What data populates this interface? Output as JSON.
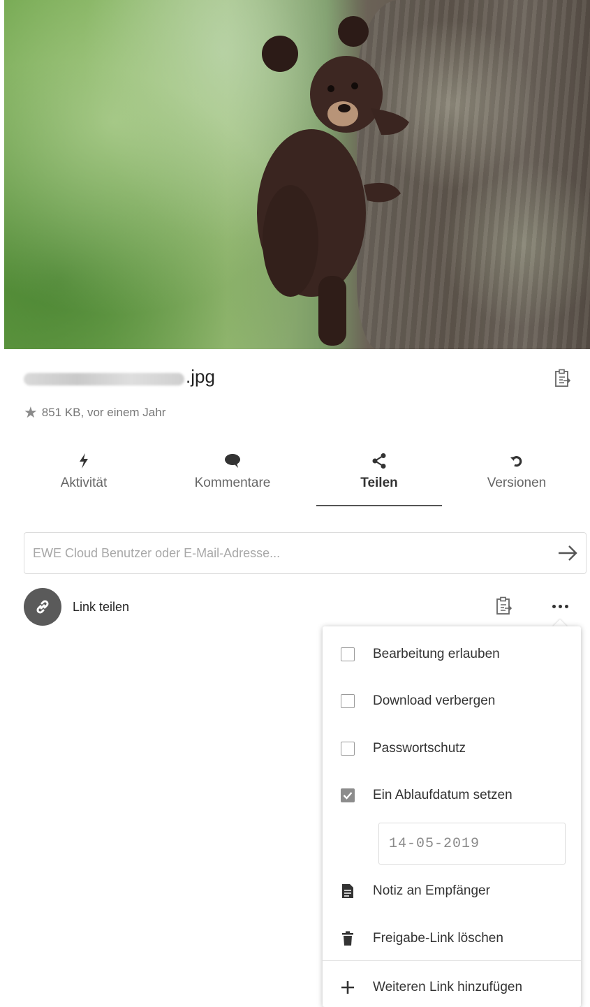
{
  "file": {
    "name_extension": ".jpg",
    "meta": "851 KB, vor einem Jahr"
  },
  "tabs": [
    {
      "label": "Aktivität",
      "icon": "bolt-icon"
    },
    {
      "label": "Kommentare",
      "icon": "comment-icon"
    },
    {
      "label": "Teilen",
      "icon": "share-icon",
      "active": true
    },
    {
      "label": "Versionen",
      "icon": "history-icon"
    }
  ],
  "share": {
    "placeholder": "EWE Cloud Benutzer oder E-Mail-Adresse..."
  },
  "link_share": {
    "label": "Link teilen"
  },
  "menu": {
    "allow_editing": {
      "label": "Bearbeitung erlauben",
      "checked": false
    },
    "hide_download": {
      "label": "Download verbergen",
      "checked": false
    },
    "password": {
      "label": "Passwortschutz",
      "checked": false
    },
    "expiration": {
      "label": "Ein Ablaufdatum setzen",
      "checked": true,
      "date": "14-05-2019"
    },
    "note": {
      "label": "Notiz an Empfänger"
    },
    "delete": {
      "label": "Freigabe-Link löschen"
    },
    "add": {
      "label": "Weiteren Link hinzufügen"
    }
  },
  "colors": {
    "accent_dark": "#5a5a5a",
    "checkbox_checked": "#8c8c8c"
  }
}
